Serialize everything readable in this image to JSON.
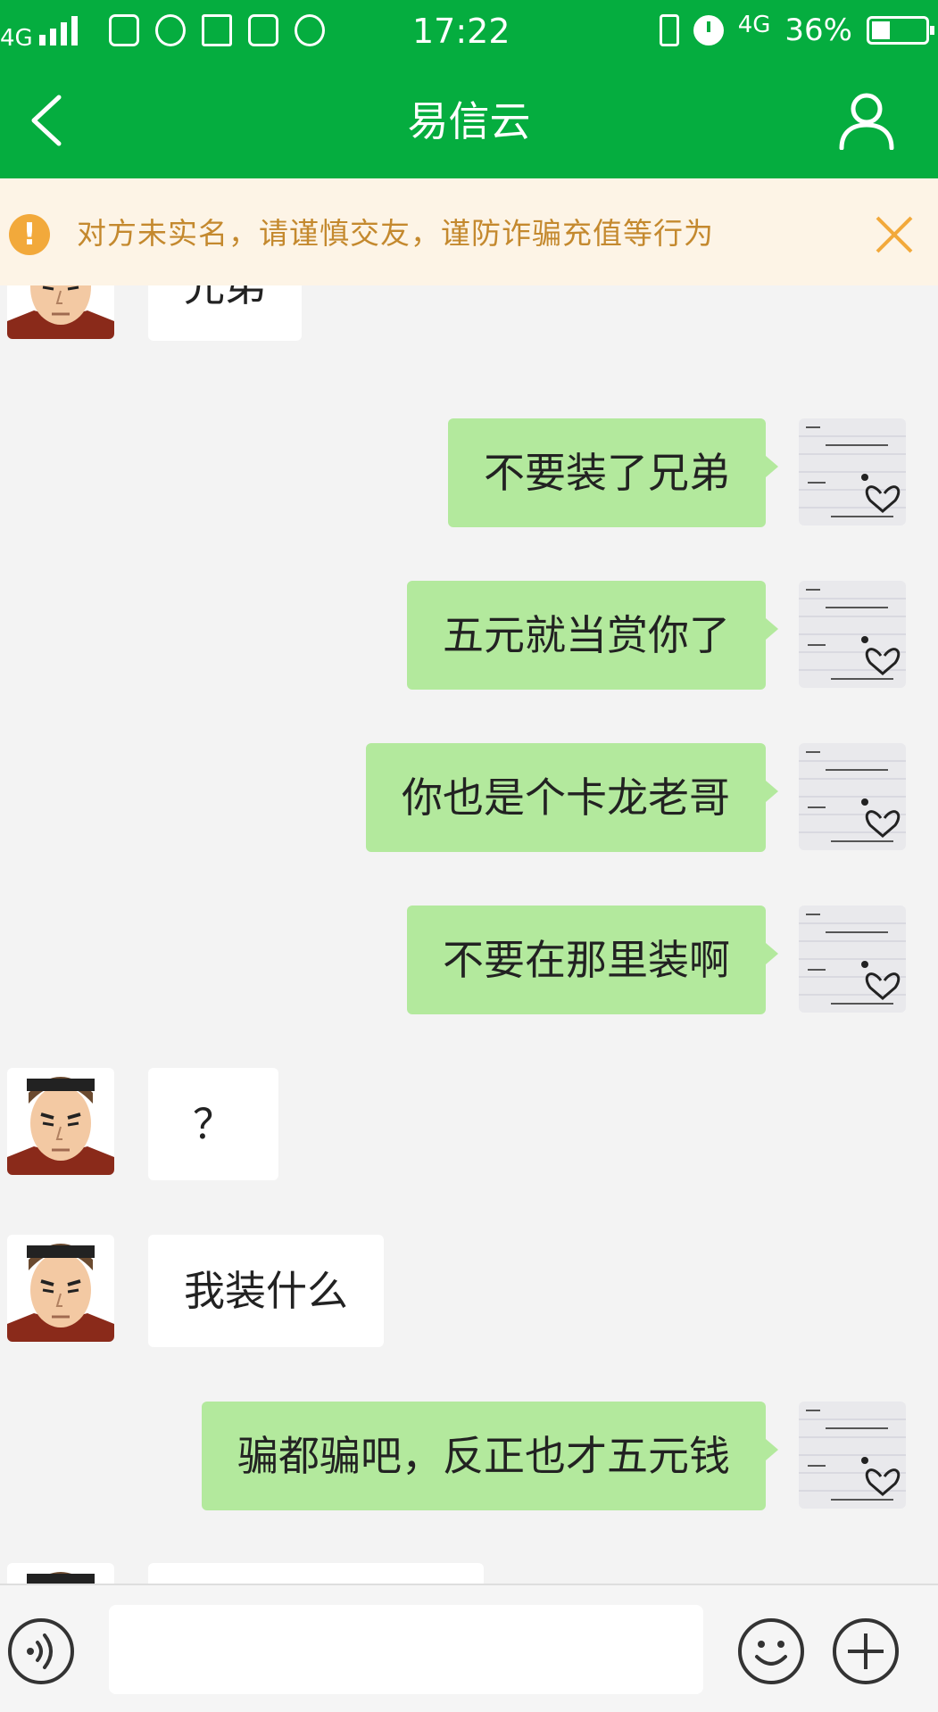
{
  "status_bar": {
    "network": "4G",
    "time": "17:22",
    "network_right": "4G",
    "battery": "36%"
  },
  "header": {
    "title": "易信云",
    "back_icon": "chevron-left-icon",
    "profile_icon": "person-icon"
  },
  "warning": {
    "text": "对方未实名，请谨慎交友，谨防诈骗充值等行为",
    "icon": "exclamation-icon",
    "close_icon": "close-icon"
  },
  "messages": [
    {
      "side": "left",
      "text": "兄弟"
    },
    {
      "side": "right",
      "text": "不要装了兄弟"
    },
    {
      "side": "right",
      "text": "五元就当赏你了"
    },
    {
      "side": "right",
      "text": "你也是个卡龙老哥"
    },
    {
      "side": "right",
      "text": "不要在那里装啊"
    },
    {
      "side": "left",
      "text": "？"
    },
    {
      "side": "left",
      "text": "我装什么"
    },
    {
      "side": "right",
      "text": "骗都骗吧，反正也才五元钱"
    },
    {
      "side": "left",
      "text": ""
    }
  ],
  "input_bar": {
    "placeholder": "",
    "voice_icon": "voice-icon",
    "emoji_icon": "smiley-icon",
    "plus_icon": "plus-icon"
  },
  "colors": {
    "brand_green": "#05ad3f",
    "sent_bubble": "#b3e99d",
    "received_bubble": "#ffffff",
    "warning_bg": "#fdf4e6",
    "warning_text": "#c4892e",
    "warning_icon": "#f2a93b"
  }
}
